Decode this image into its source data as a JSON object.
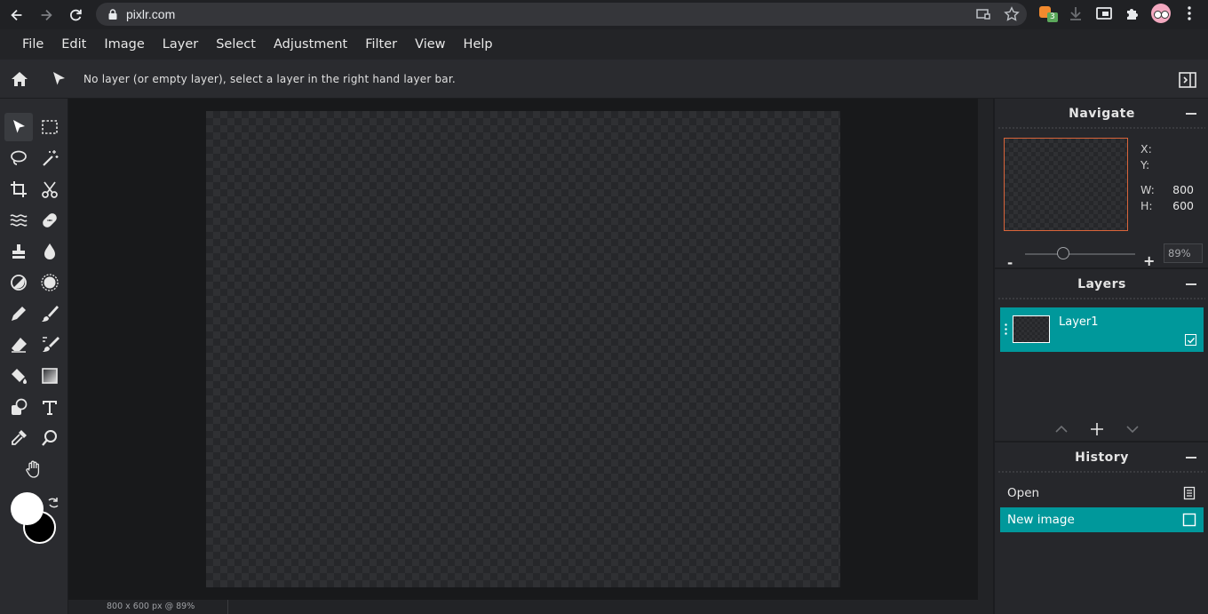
{
  "browser": {
    "url": "pixlr.com",
    "extension_badge": "3"
  },
  "menu": {
    "items": [
      "File",
      "Edit",
      "Image",
      "Layer",
      "Select",
      "Adjustment",
      "Filter",
      "View",
      "Help"
    ]
  },
  "options_bar": {
    "message": "No layer (or empty layer), select a layer in the right hand layer bar."
  },
  "toolbar": {
    "tools": [
      "arrange-tool-icon",
      "marquee-tool-icon",
      "lasso-tool-icon",
      "wand-tool-icon",
      "crop-tool-icon",
      "cut-tool-icon",
      "liquify-tool-icon",
      "heal-tool-icon",
      "clone-stamp-tool-icon",
      "blur-tool-icon",
      "dodge-burn-tool-icon",
      "sponge-tool-icon",
      "pencil-tool-icon",
      "brush-tool-icon",
      "eraser-tool-icon",
      "replace-color-tool-icon",
      "fill-tool-icon",
      "gradient-tool-icon",
      "shape-tool-icon",
      "text-tool-icon",
      "eyedropper-tool-icon",
      "zoom-tool-icon",
      "hand-tool-icon"
    ],
    "foreground_color": "#ffffff",
    "background_color": "#000000"
  },
  "status": {
    "text": "800 x 600 px @ 89%"
  },
  "navigate": {
    "title": "Navigate",
    "x_label": "X:",
    "y_label": "Y:",
    "w_label": "W:",
    "h_label": "H:",
    "w_value": "800",
    "h_value": "600",
    "zoom_minus": "-",
    "zoom_plus": "+",
    "zoom_value": "89%"
  },
  "layers": {
    "title": "Layers",
    "items": [
      {
        "name": "Layer1",
        "visible": true,
        "selected": true
      }
    ]
  },
  "history": {
    "title": "History",
    "items": [
      {
        "label": "Open",
        "active": false
      },
      {
        "label": "New image",
        "active": true
      }
    ]
  },
  "colors": {
    "accent": "#00989b",
    "nav_frame": "#d9643a"
  }
}
